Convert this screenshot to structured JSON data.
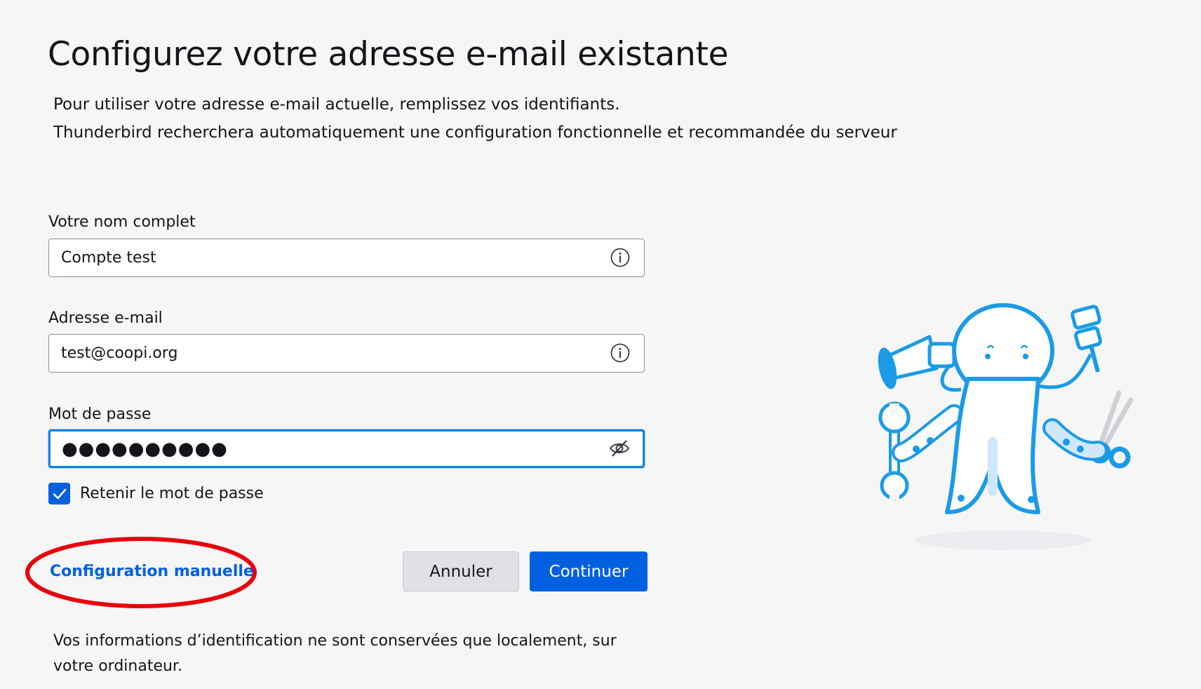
{
  "header": {
    "title": "Configurez votre adresse e-mail existante",
    "subtitle_line1": "Pour utiliser votre adresse e-mail actuelle, remplissez vos identifiants.",
    "subtitle_line2": "Thunderbird recherchera automatiquement une configuration fonctionnelle et recommandée du serveur"
  },
  "form": {
    "name": {
      "label": "Votre nom complet",
      "value": "Compte test",
      "icon": "info-icon"
    },
    "email": {
      "label": "Adresse e-mail",
      "value": "test@coopi.org",
      "icon": "info-icon"
    },
    "password": {
      "label": "Mot de passe",
      "value": "●●●●●●●●●●",
      "icon": "eye-slash-icon"
    },
    "remember": {
      "label": "Retenir le mot de passe",
      "checked": true
    }
  },
  "actions": {
    "manual_config": "Configuration manuelle",
    "cancel": "Annuler",
    "continue": "Continuer"
  },
  "footer": {
    "note": "Vos informations d’identification ne sont conservées que localement, sur votre ordinateur."
  },
  "colors": {
    "accent": "#0060df",
    "focus_ring": "#0a84e0",
    "annotation": "#e8000b",
    "illustration": "#1a9be6"
  },
  "illustration": {
    "name": "thunderbird-octopus-mascot"
  }
}
